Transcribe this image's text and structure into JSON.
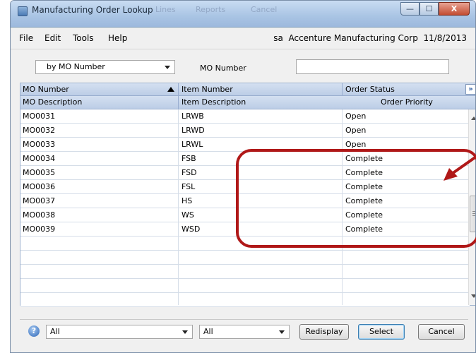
{
  "window": {
    "title": "Manufacturing Order Lookup",
    "ghost_toolbar": [
      "Lines",
      "Reports",
      "Cancel"
    ],
    "controls": {
      "minimize": "—",
      "maximize": "☐",
      "close": "X"
    }
  },
  "menu": {
    "items": [
      "File",
      "Edit",
      "Tools",
      "Help"
    ],
    "user": "sa",
    "company": "Accenture Manufacturing Corp",
    "date": "11/8/2013"
  },
  "search": {
    "sort_by": "by MO Number",
    "field_label": "MO Number",
    "field_value": ""
  },
  "grid": {
    "header_row1": [
      "MO Number",
      "Item Number",
      "Order Status"
    ],
    "header_row2": [
      "MO Description",
      "Item Description",
      "Order Priority"
    ],
    "rows": [
      {
        "mo": "MO0031",
        "item": "LRWB",
        "status": "Open"
      },
      {
        "mo": "MO0032",
        "item": "LRWD",
        "status": "Open"
      },
      {
        "mo": "MO0033",
        "item": "LRWL",
        "status": "Open"
      },
      {
        "mo": "MO0034",
        "item": "FSB",
        "status": "Complete"
      },
      {
        "mo": "MO0035",
        "item": "FSD",
        "status": "Complete"
      },
      {
        "mo": "MO0036",
        "item": "FSL",
        "status": "Complete"
      },
      {
        "mo": "MO0037",
        "item": "HS",
        "status": "Complete"
      },
      {
        "mo": "MO0038",
        "item": "WS",
        "status": "Complete"
      },
      {
        "mo": "MO0039",
        "item": "WSD",
        "status": "Complete"
      }
    ],
    "empty_rows": 5
  },
  "footer": {
    "filter1": "All",
    "filter2": "All",
    "redisplay": "Redisplay",
    "select": "Select",
    "cancel": "Cancel",
    "help": "?"
  },
  "colors": {
    "annotation": "#b01818",
    "header": "#c8d7ec"
  }
}
